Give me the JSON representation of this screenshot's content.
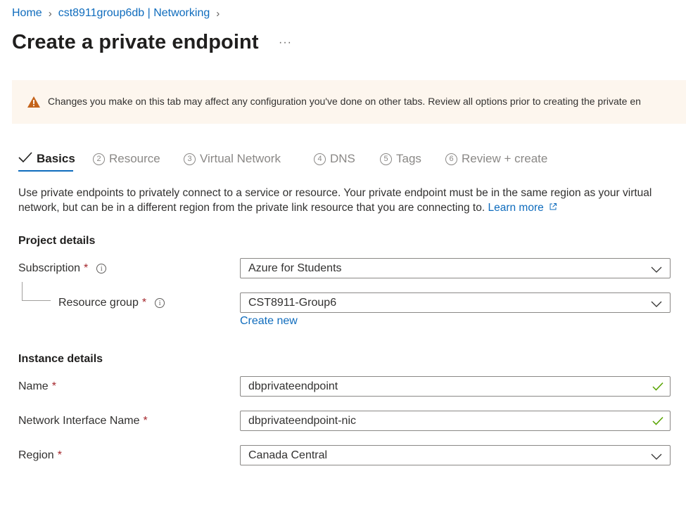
{
  "breadcrumb": {
    "home": "Home",
    "resource": "cst8911group6db | Networking",
    "separator": "›"
  },
  "page": {
    "title": "Create a private endpoint",
    "more_label": "···"
  },
  "warning": {
    "text": "Changes you make on this tab may affect any configuration you've done on other tabs. Review all options prior to creating the private en"
  },
  "tabs": [
    {
      "label": "Basics",
      "number": "",
      "state": "completed-active"
    },
    {
      "label": "Resource",
      "number": "2"
    },
    {
      "label": "Virtual Network",
      "number": "3"
    },
    {
      "label": "DNS",
      "number": "4"
    },
    {
      "label": "Tags",
      "number": "5"
    },
    {
      "label": "Review + create",
      "number": "6"
    }
  ],
  "description": {
    "text": "Use private endpoints to privately connect to a service or resource. Your private endpoint must be in the same region as your virtual network, but can be in a different region from the private link resource that you are connecting to.",
    "learn_more": "Learn more"
  },
  "project_details": {
    "heading": "Project details",
    "subscription": {
      "label": "Subscription",
      "required": "*",
      "value": "Azure for Students"
    },
    "resource_group": {
      "label": "Resource group",
      "required": "*",
      "value": "CST8911-Group6",
      "create_new": "Create new"
    }
  },
  "instance_details": {
    "heading": "Instance details",
    "name": {
      "label": "Name",
      "required": "*",
      "value": "dbprivateendpoint"
    },
    "nic_name": {
      "label": "Network Interface Name",
      "required": "*",
      "value": "dbprivateendpoint-nic"
    },
    "region": {
      "label": "Region",
      "required": "*",
      "value": "Canada Central"
    }
  },
  "colors": {
    "link": "#0f6cbd",
    "warning_bg": "#fdf6ee",
    "warning_icon": "#c4631a",
    "required": "#a4262c",
    "valid_check": "#57a300"
  },
  "icons": {
    "warning": "warning-triangle-icon",
    "info": "info-icon",
    "chevron": "chevron-down-icon",
    "valid": "checkmark-icon",
    "external": "external-link-icon"
  }
}
